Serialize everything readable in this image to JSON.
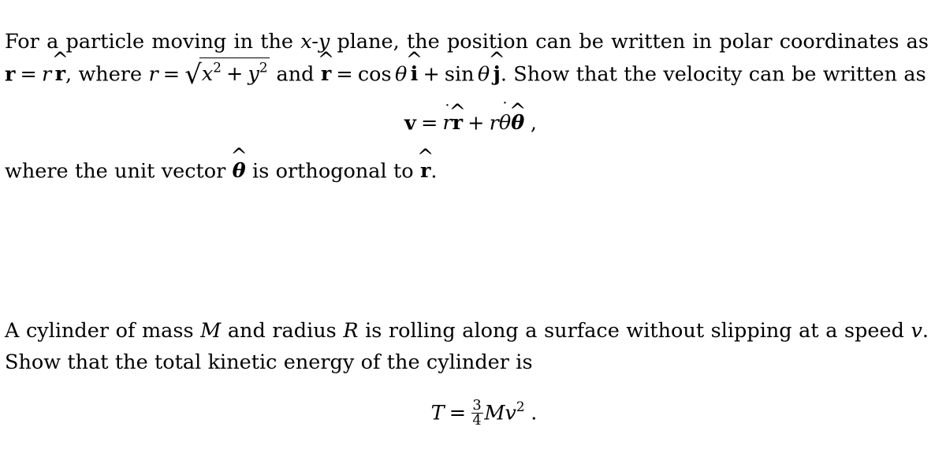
{
  "document": {
    "type": "physics-problem-set",
    "background_color": "#ffffff",
    "text_color": "#000000"
  },
  "problems": [
    {
      "id": "problem-1",
      "topic": "polar coordinates velocity",
      "text": {
        "seg_1": "For a particle moving in the ",
        "var_x": "x",
        "dash": "-",
        "var_y": "y",
        "seg_2": " plane, the position can be written in polar coordinates as ",
        "vec_r_bold": "r",
        "eq_1": "=",
        "var_r_1": "r",
        "unit_r_1": "r",
        "seg_3": ", where ",
        "var_r_2": "r",
        "eq_2": "=",
        "radical": "√",
        "rad_x": "x",
        "rad_x_exp": "2",
        "rad_plus": "+",
        "rad_y": "y",
        "rad_y_exp": "2",
        "seg_4": " and ",
        "unit_r_2": "r",
        "eq_3": "=",
        "cos": "cos",
        "theta_1": "θ",
        "unit_i": "i",
        "plus_1": "+",
        "sin": "sin",
        "theta_2": "θ",
        "unit_j": "j",
        "seg_5": ". Show that the velocity can be written as"
      },
      "equation": {
        "label": "velocity-polar",
        "v": "v",
        "equals": "=",
        "r_dot": "r",
        "r_dot_accent": "˙",
        "unit_r": "r",
        "plus": "+",
        "r": "r",
        "theta_dot": "θ",
        "theta_dot_accent": "˙",
        "unit_theta": "θ",
        "comma": ","
      },
      "closing": {
        "seg_1": "where the unit vector ",
        "unit_theta": "θ",
        "seg_2": " is orthogonal to ",
        "unit_r": "r",
        "seg_3": "."
      }
    },
    {
      "id": "problem-2",
      "topic": "rolling cylinder kinetic energy",
      "text": {
        "seg_1": "A cylinder of mass ",
        "var_M": "M",
        "seg_2": " and radius ",
        "var_R": "R",
        "seg_3": " is rolling along a surface without slipping at a speed ",
        "var_v": "v",
        "seg_4": ". Show that the total kinetic energy of the cylinder is"
      },
      "equation": {
        "label": "kinetic-energy-cylinder",
        "T": "T",
        "equals": "=",
        "frac_numer": "3",
        "frac_denom": "4",
        "M": "M",
        "v": "v",
        "v_exp": "2",
        "period": "."
      }
    }
  ],
  "glyphs": {
    "hat": "^",
    "dot": "˙",
    "radical": "√"
  }
}
